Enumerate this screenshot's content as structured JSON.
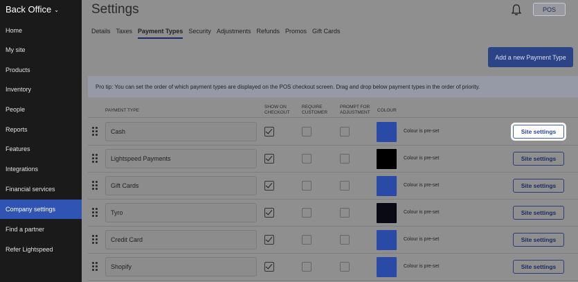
{
  "sidebar": {
    "brand": "Back Office",
    "items": [
      {
        "label": "Home"
      },
      {
        "label": "My site"
      },
      {
        "label": "Products"
      },
      {
        "label": "Inventory"
      },
      {
        "label": "People"
      },
      {
        "label": "Reports"
      },
      {
        "label": "Features"
      },
      {
        "label": "Integrations"
      },
      {
        "label": "Financial services"
      },
      {
        "label": "Company settings",
        "active": true
      },
      {
        "label": "Find a partner"
      },
      {
        "label": "Refer Lightspeed"
      }
    ]
  },
  "header": {
    "title": "Settings",
    "pos_label": "POS"
  },
  "tabs": [
    {
      "label": "Details"
    },
    {
      "label": "Taxes"
    },
    {
      "label": "Payment Types",
      "active": true
    },
    {
      "label": "Security"
    },
    {
      "label": "Adjustments"
    },
    {
      "label": "Refunds"
    },
    {
      "label": "Promos"
    },
    {
      "label": "Gift Cards"
    }
  ],
  "add_button_label": "Add a new Payment Type",
  "pro_tip": "Pro tip: You can set the order of which payment types are displayed on the POS checkout screen. Drag and drop below payment types in the order of priority.",
  "table": {
    "headers": {
      "payment_type": "PAYMENT TYPE",
      "show_on_checkout": "SHOW ON\nCHECKOUT",
      "require_customer": "REQUIRE\nCUSTOMER",
      "prompt_for_adjustment": "PROMPT FOR\nADJUSTMENT",
      "colour": "COLOUR"
    },
    "rows": [
      {
        "name": "Cash",
        "show": true,
        "require": false,
        "prompt": false,
        "colour": "#2a4aa8",
        "colour_note": "Colour is pre-set",
        "button": "Site settings",
        "highlight": true
      },
      {
        "name": "Lightspeed Payments",
        "show": true,
        "require": false,
        "prompt": false,
        "colour": "#000000",
        "colour_note": "Colour is pre-set",
        "button": "Site settings"
      },
      {
        "name": "Gift Cards",
        "show": true,
        "require": false,
        "prompt": false,
        "colour": "#2a4aa8",
        "colour_note": "Colour is pre-set",
        "button": "Site settings"
      },
      {
        "name": "Tyro",
        "show": true,
        "require": false,
        "prompt": false,
        "colour": "#0a0a14",
        "colour_note": "Colour is pre-set",
        "button": "Site settings"
      },
      {
        "name": "Credit Card",
        "show": true,
        "require": false,
        "prompt": false,
        "colour": "#2a4aa8",
        "colour_note": "Colour is pre-set",
        "button": "Site settings"
      },
      {
        "name": "Shopify",
        "show": true,
        "require": false,
        "prompt": false,
        "colour": "#2a4aa8",
        "colour_note": "Colour is pre-set",
        "button": "Site settings"
      }
    ]
  }
}
